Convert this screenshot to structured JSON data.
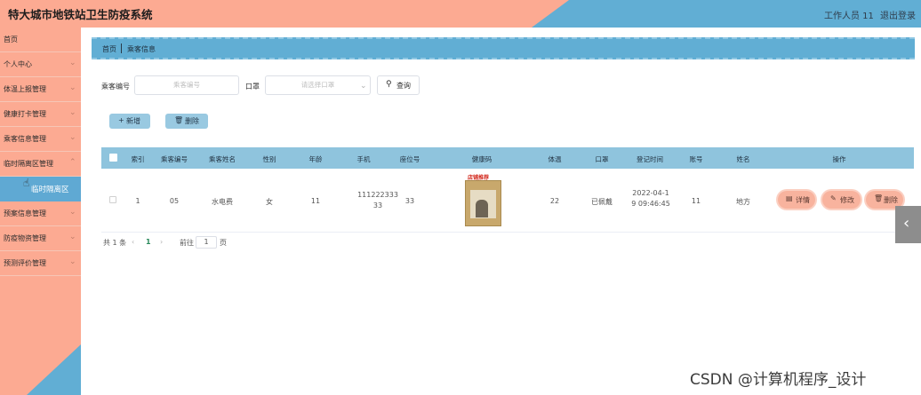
{
  "header": {
    "title": "特大城市地铁站卫生防疫系统",
    "user": "工作人员 11",
    "logout": "退出登录"
  },
  "sidebar": {
    "items": [
      {
        "label": "首页",
        "chevron": false
      },
      {
        "label": "个人中心",
        "chevron": true
      },
      {
        "label": "体温上报管理",
        "chevron": true
      },
      {
        "label": "健康打卡管理",
        "chevron": true
      },
      {
        "label": "乘客信息管理",
        "chevron": true
      },
      {
        "label": "临时隔离区管理",
        "chevron": true
      },
      {
        "label": "预案信息管理",
        "chevron": true
      },
      {
        "label": "防疫物资管理",
        "chevron": true
      },
      {
        "label": "预测评价管理",
        "chevron": true
      }
    ],
    "active_sub_item": "临时隔离区"
  },
  "breadcrumb": {
    "home": "首页",
    "current": "乘客信息"
  },
  "search": {
    "passenger_no_label": "乘客编号",
    "passenger_no_placeholder": "乘客编号",
    "mask_label": "口罩",
    "mask_placeholder": "请选择口罩",
    "query_button": "查询"
  },
  "actions": {
    "add": "新增",
    "delete": "删除"
  },
  "table": {
    "columns": [
      "索引",
      "乘客编号",
      "乘客姓名",
      "性别",
      "年龄",
      "手机",
      "座位号",
      "健康码",
      "体温",
      "口罩",
      "登记时间",
      "账号",
      "姓名",
      "操作"
    ],
    "rows": [
      {
        "index": "1",
        "passenger_no": "05",
        "passenger_name": "水电费",
        "gender": "女",
        "age": "11",
        "phone_line1": "111222333",
        "phone_line2": "33",
        "seat": "33",
        "health_code_caption": "店铺推荐",
        "temperature": "22",
        "mask": "已佩戴",
        "time_line1": "2022-04-1",
        "time_line2": "9 09:46:45",
        "account": "11",
        "name": "地方",
        "ops": [
          "详情",
          "修改",
          "删除"
        ]
      }
    ]
  },
  "pagination": {
    "total": "共 1 条",
    "current_page": "1",
    "goto_label": "前往",
    "goto_value": "1",
    "page_suffix": "页"
  },
  "watermark": "CSDN @计算机程序_设计",
  "colors": {
    "salmon": "#fcaa92",
    "blue": "#61aed4",
    "table_header": "#8fc4dd"
  }
}
